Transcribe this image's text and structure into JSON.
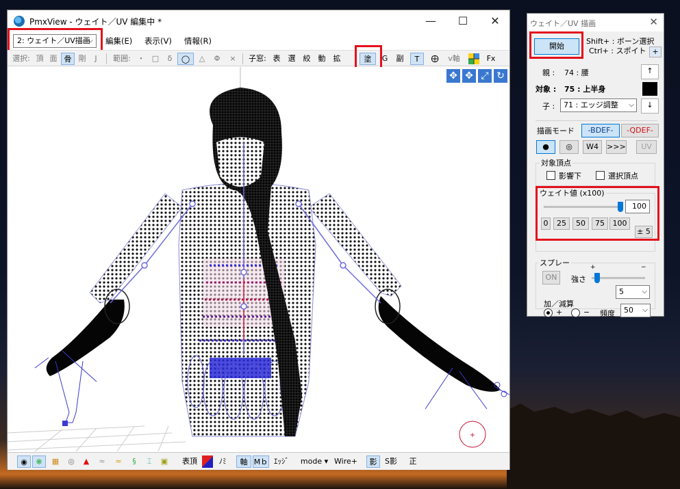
{
  "main_window": {
    "title": "PmxView  - ウェイト／UV 編集中 *",
    "minimize_glyph": "—",
    "maximize_glyph": "☐",
    "close_glyph": "✕"
  },
  "menubar": {
    "mode_select": "2: ウェイト／UV描画",
    "items": [
      "編集(E)",
      "表示(V)",
      "情報(R)"
    ]
  },
  "toolbar": {
    "select_label": "選択:",
    "select_items": [
      "頂",
      "面",
      "骨",
      "剛",
      "J"
    ],
    "range_label": "範囲:",
    "range_items": [
      "・",
      "□",
      "δ",
      "◯",
      "△",
      "Φ",
      "×"
    ],
    "child_label": "子窓:",
    "child_items": [
      "表",
      "選",
      "絞",
      "動",
      "拡",
      "塗",
      "G",
      "副",
      "T"
    ],
    "vaxis_label": "v軸",
    "fx_label": "Fx"
  },
  "bottombar": {
    "front_vertex_label": "表頂",
    "mi_label": "ﾉﾐ",
    "axis_label": "軸",
    "md_label": "Mｂ",
    "edge_label": "ｴｯｼﾞ",
    "mode_label": "mode ▾",
    "wire_label": "Wire+",
    "shadow_label": "影",
    "s_shadow_label": "S影",
    "front_label": "正"
  },
  "side_panel": {
    "title": "ウェイト／UV 描画",
    "start_button": "開始",
    "hint_bone": "Shift+ : ボーン選択",
    "hint_dropper": "Ctrl+ : スポイト",
    "plus_button": "+",
    "parent_label": "親 :",
    "parent_value": "74 : 腰",
    "target_label": "対象 :",
    "target_value": "75 : 上半身",
    "child_label": "子 :",
    "child_value": "71 : エッジ調整",
    "up_button": "↑",
    "down_button": "↓",
    "draw_mode_label": "描画モード",
    "bdef_button": "-BDEF-",
    "qdef_button": "-QDEF-",
    "brush_buttons": [
      "●",
      "◎",
      "W4",
      ">>>",
      "UV"
    ],
    "target_vertex_group": "対象頂点",
    "influence_label": "影響下",
    "selected_vertex_label": "選択頂点",
    "weight_group": "ウェイト値 (x100)",
    "weight_value": "100",
    "weight_level": 1.0,
    "weight_presets": [
      "0",
      "25",
      "50",
      "75",
      "100"
    ],
    "pm5_button": "± 5",
    "spray_group": "スプレー",
    "spray_on_button": "ON",
    "strength_label": "強さ",
    "strength_plus": "+",
    "strength_minus": "−",
    "strength_level": 0.05,
    "strength_value": "5",
    "addsub_label": "加／減算",
    "add_label": "+",
    "sub_label": "−",
    "freq_label": "頻度",
    "freq_value": "50"
  },
  "colors": {
    "highlight": "#e3101c",
    "toggle_on": "#cfe3f5",
    "accent_blue": "#0078d7",
    "mesh_blue": "#2a2ad8"
  }
}
